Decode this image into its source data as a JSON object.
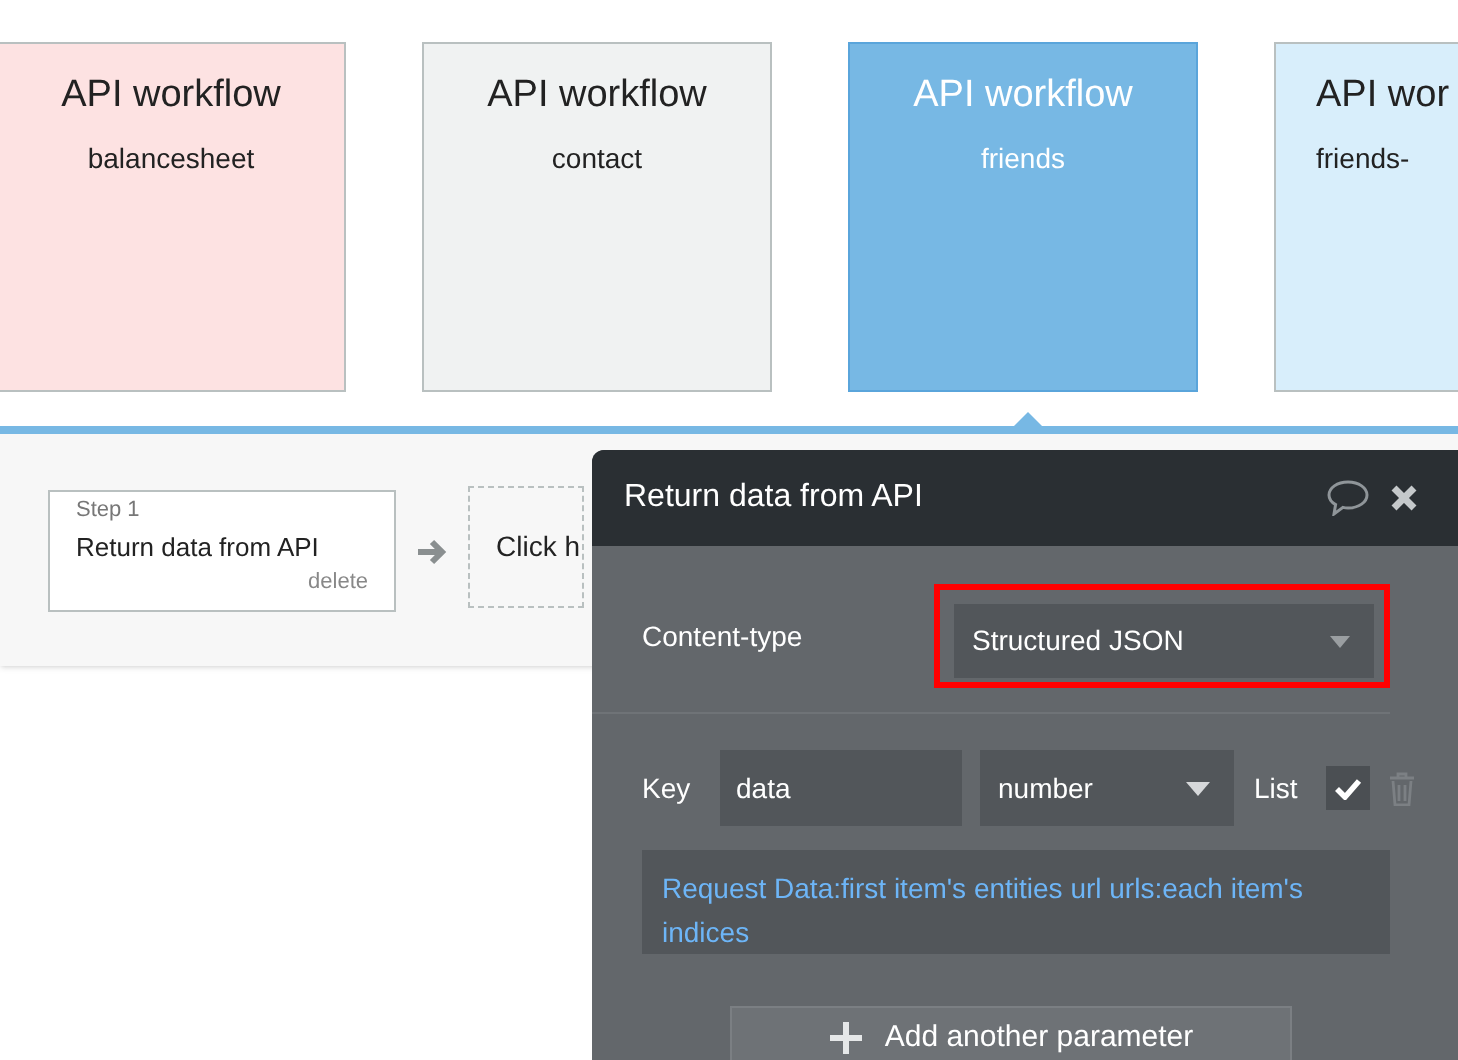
{
  "workflows": [
    {
      "title": "API workflow",
      "name": "balancesheet",
      "color": "#fde2e2",
      "selected": false
    },
    {
      "title": "API workflow",
      "name": "contact",
      "color": "#f0f2f2",
      "selected": false
    },
    {
      "title": "API workflow",
      "name": "friends",
      "color": "#77b8e4",
      "selected": true
    },
    {
      "title": "API wor",
      "name": "friends-",
      "color": "#d8eefb",
      "selected": false
    }
  ],
  "steps": [
    {
      "label": "Step 1",
      "action": "Return data from API",
      "delete": "delete"
    }
  ],
  "add_step": {
    "label": "Click h"
  },
  "panel": {
    "title": "Return data from API",
    "content_type": {
      "label": "Content-type",
      "value": "Structured JSON"
    },
    "parameters": [
      {
        "key_label": "Key",
        "key": "data",
        "type": "number",
        "list_label": "List",
        "list": true,
        "value": "Request Data:first item's entities url urls:each item's indices"
      }
    ],
    "add_button": "Add another parameter"
  }
}
